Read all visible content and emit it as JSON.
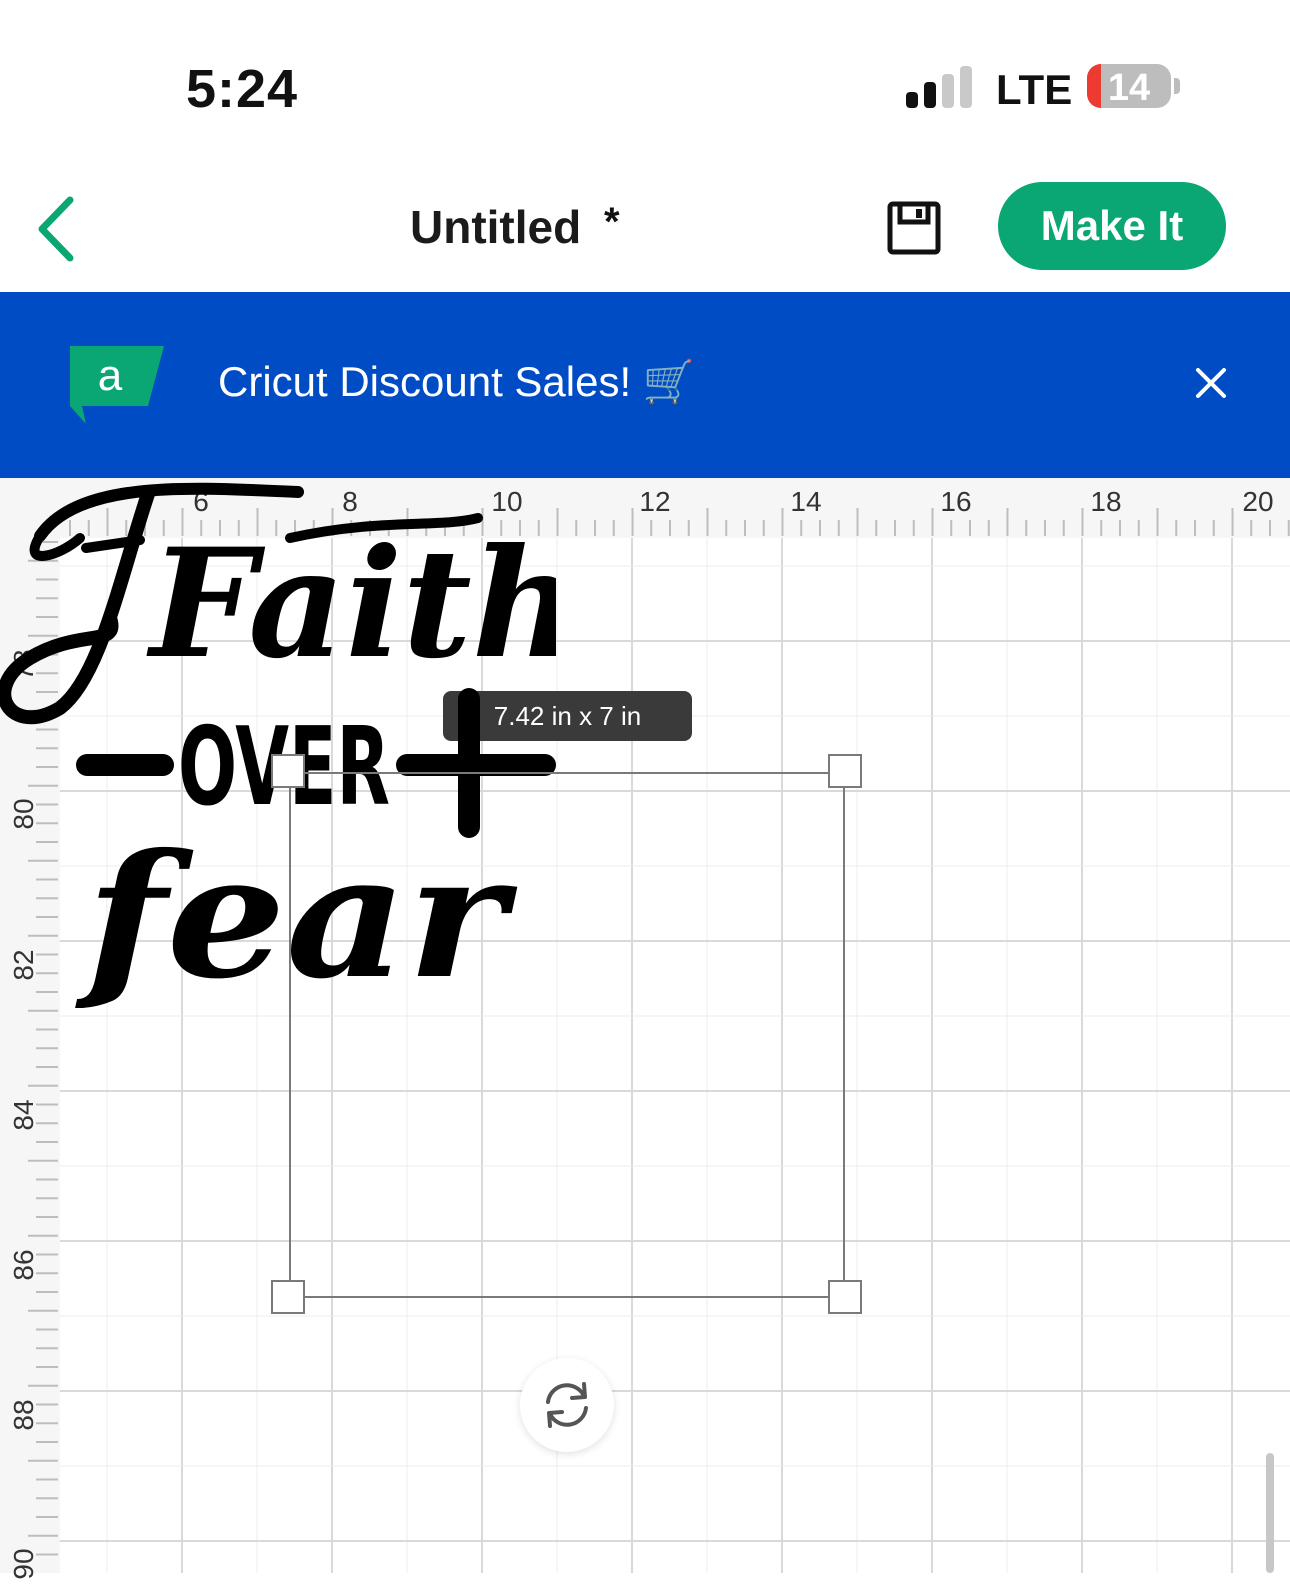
{
  "status_bar": {
    "time": "5:24",
    "network": "LTE",
    "battery_level": "14",
    "signal_bars": 2,
    "battery_color": "#ee3b32"
  },
  "header": {
    "back_icon": "chevron-left-icon",
    "title": "Untitled",
    "unsaved_marker": "*",
    "save_icon": "floppy-disk-icon",
    "make_it_label": "Make It",
    "accent_color": "#0aa673"
  },
  "banner": {
    "logo_letter": "a",
    "text": "Cricut Discount Sales! 🛒",
    "close_icon": "close-icon",
    "background_color": "#004cc4"
  },
  "canvas": {
    "ruler_top_labels": [
      "6",
      "8",
      "10",
      "12",
      "14",
      "16",
      "18",
      "20"
    ],
    "ruler_left_labels": [
      "78",
      "80",
      "82",
      "84",
      "86",
      "88",
      "90"
    ],
    "dimension_label": "7.42 in x 7 in",
    "design_words": {
      "line1": "Faith",
      "line2": "OVER",
      "line3": "fear"
    },
    "rotate_icon": "rotate-icon"
  }
}
